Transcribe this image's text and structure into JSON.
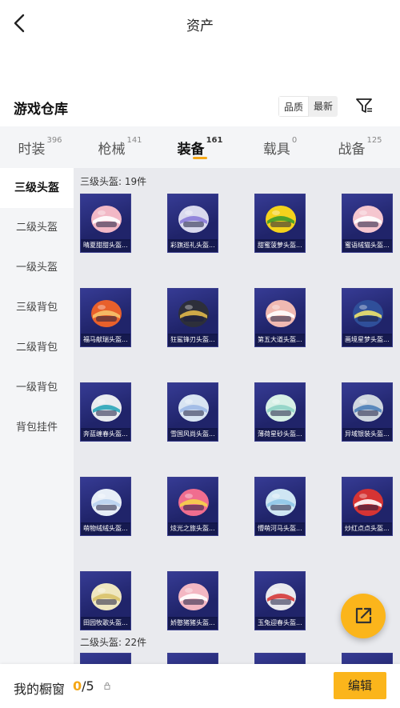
{
  "header": {
    "title": "资产"
  },
  "section": {
    "title": "游戏仓库",
    "sort_options": [
      "品质",
      "最新"
    ],
    "active_sort": 0
  },
  "tabs": [
    {
      "label": "时装",
      "count": "396"
    },
    {
      "label": "枪械",
      "count": "141"
    },
    {
      "label": "装备",
      "count": "161",
      "active": true
    },
    {
      "label": "载具",
      "count": "0"
    },
    {
      "label": "战备",
      "count": "125"
    }
  ],
  "sidebar": {
    "items": [
      {
        "label": "三级头盔",
        "active": true
      },
      {
        "label": "二级头盔"
      },
      {
        "label": "一级头盔"
      },
      {
        "label": "三级背包"
      },
      {
        "label": "二级背包"
      },
      {
        "label": "一级背包"
      },
      {
        "label": "背包挂件"
      }
    ]
  },
  "groups": [
    {
      "label": "三级头盔: 19件",
      "items": [
        {
          "name": "晴夏甜甜头盔...",
          "color": "#f2b8c6",
          "accent": "#ffffff"
        },
        {
          "name": "彩旗巡礼头盔...",
          "color": "#d9d9ee",
          "accent": "#8a7bd8"
        },
        {
          "name": "甜蜜菠萝头盔...",
          "color": "#f4d21c",
          "accent": "#3c9a2e"
        },
        {
          "name": "蜜语绒猫头盔...",
          "color": "#f5c6cf",
          "accent": "#ffffff"
        },
        {
          "name": "福马献瑞头盔...",
          "color": "#e8602b",
          "accent": "#f7c36a"
        },
        {
          "name": "狂鲨锋刃头盔...",
          "color": "#2d2f3a",
          "accent": "#e0b84a"
        },
        {
          "name": "第五大道头盔...",
          "color": "#f0b9b2",
          "accent": "#ffffff"
        },
        {
          "name": "画境星梦头盔...",
          "color": "#2f4f9a",
          "accent": "#f0e36b"
        },
        {
          "name": "奔蓝缠春头盔...",
          "color": "#e9ecef",
          "accent": "#2aa6b8"
        },
        {
          "name": "雪国风尚头盔...",
          "color": "#d8e4f2",
          "accent": "#9db8e6"
        },
        {
          "name": "薄荷星砂头盔...",
          "color": "#d7f0e6",
          "accent": "#8fd3c5"
        },
        {
          "name": "异域银装头盔...",
          "color": "#cfd6df",
          "accent": "#4d7fb8"
        },
        {
          "name": "萌物绒绒头盔...",
          "color": "#e7eef7",
          "accent": "#b9d2ee"
        },
        {
          "name": "炫光之旅头盔...",
          "color": "#f06d8f",
          "accent": "#f5d34a"
        },
        {
          "name": "懵萌河马头盔...",
          "color": "#cfe6f3",
          "accent": "#8fc6e8"
        },
        {
          "name": "炒红点点头盔...",
          "color": "#d63434",
          "accent": "#ffffff"
        },
        {
          "name": "田园牧歌头盔...",
          "color": "#efe7c0",
          "accent": "#d8c26a"
        },
        {
          "name": "娇憨猪猪头盔...",
          "color": "#f3b7c3",
          "accent": "#ffffff"
        },
        {
          "name": "玉兔迎春头盔...",
          "color": "#e9e9ee",
          "accent": "#d53a3a"
        }
      ]
    },
    {
      "label": "二级头盔: 22件",
      "items": []
    }
  ],
  "cabinet": {
    "label": "我的橱窗",
    "current": "0",
    "total": "/5"
  },
  "edit_label": "编辑",
  "colors": {
    "accent": "#fbb51b",
    "card_bg": "#262a73"
  }
}
